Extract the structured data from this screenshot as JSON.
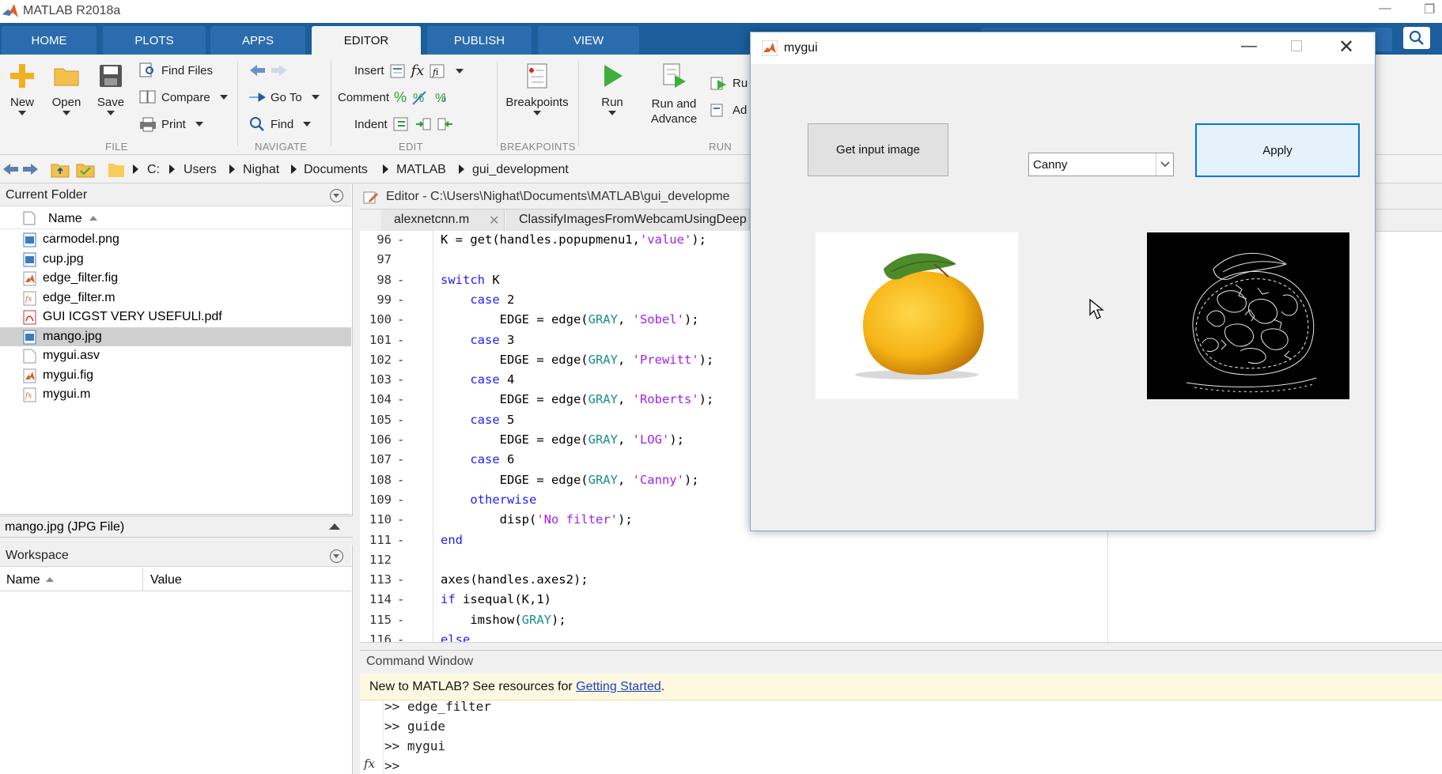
{
  "app": {
    "title": "MATLAB R2018a"
  },
  "ribbon": {
    "tabs": [
      "HOME",
      "PLOTS",
      "APPS",
      "EDITOR",
      "PUBLISH",
      "VIEW"
    ],
    "file": {
      "new": "New",
      "open": "Open",
      "save": "Save",
      "find_files": "Find Files",
      "compare": "Compare",
      "print": "Print",
      "group": "FILE"
    },
    "navigate": {
      "go_to": "Go To",
      "find": "Find",
      "group": "NAVIGATE"
    },
    "edit": {
      "insert": "Insert",
      "comment": "Comment",
      "indent": "Indent",
      "group": "EDIT"
    },
    "breakpoints": {
      "label": "Breakpoints",
      "group": "BREAKPOINTS"
    },
    "run": {
      "run": "Run",
      "run_advance_1": "Run and",
      "run_advance_2": "Advance",
      "run_section": "Ru",
      "advance": "Ad",
      "group": "RUN"
    }
  },
  "address": {
    "crumbs": [
      "C:",
      "Users",
      "Nighat",
      "Documents",
      "MATLAB",
      "gui_development"
    ]
  },
  "current_folder": {
    "title": "Current Folder",
    "column": "Name",
    "files": [
      {
        "name": "carmodel.png",
        "icon": "image-file-icon"
      },
      {
        "name": "cup.jpg",
        "icon": "image-file-icon"
      },
      {
        "name": "edge_filter.fig",
        "icon": "fig-file-icon"
      },
      {
        "name": "edge_filter.m",
        "icon": "m-file-icon"
      },
      {
        "name": "GUI ICGST VERY USEFULl.pdf",
        "icon": "pdf-file-icon"
      },
      {
        "name": "mango.jpg",
        "icon": "image-file-icon"
      },
      {
        "name": "mygui.asv",
        "icon": "generic-file-icon"
      },
      {
        "name": "mygui.fig",
        "icon": "fig-file-icon"
      },
      {
        "name": "mygui.m",
        "icon": "m-file-icon"
      }
    ],
    "selected": "mango.jpg",
    "details": "mango.jpg  (JPG File)"
  },
  "workspace": {
    "title": "Workspace",
    "col_name": "Name",
    "col_value": "Value"
  },
  "editor": {
    "header": "Editor - C:\\Users\\Nighat\\Documents\\MATLAB\\gui_developme",
    "tabs": [
      "alexnetcnn.m",
      "ClassifyImagesFromWebcamUsingDeep"
    ],
    "lines": [
      {
        "n": "96",
        "d": "-",
        "code": "K = get(handles.popupmenu1,'value');"
      },
      {
        "n": "97",
        "d": "",
        "code": ""
      },
      {
        "n": "98",
        "d": "-",
        "code": "switch K"
      },
      {
        "n": "99",
        "d": "-",
        "code": "    case 2"
      },
      {
        "n": "100",
        "d": "-",
        "code": "        EDGE = edge(GRAY, 'Sobel');"
      },
      {
        "n": "101",
        "d": "-",
        "code": "    case 3"
      },
      {
        "n": "102",
        "d": "-",
        "code": "        EDGE = edge(GRAY, 'Prewitt');"
      },
      {
        "n": "103",
        "d": "-",
        "code": "    case 4"
      },
      {
        "n": "104",
        "d": "-",
        "code": "        EDGE = edge(GRAY, 'Roberts');"
      },
      {
        "n": "105",
        "d": "-",
        "code": "    case 5"
      },
      {
        "n": "106",
        "d": "-",
        "code": "        EDGE = edge(GRAY, 'LOG');"
      },
      {
        "n": "107",
        "d": "-",
        "code": "    case 6"
      },
      {
        "n": "108",
        "d": "-",
        "code": "        EDGE = edge(GRAY, 'Canny');"
      },
      {
        "n": "109",
        "d": "-",
        "code": "    otherwise"
      },
      {
        "n": "110",
        "d": "-",
        "code": "        disp('No filter');"
      },
      {
        "n": "111",
        "d": "-",
        "code": "end"
      },
      {
        "n": "112",
        "d": "",
        "code": ""
      },
      {
        "n": "113",
        "d": "-",
        "code": "axes(handles.axes2);"
      },
      {
        "n": "114",
        "d": "-",
        "code": "if isequal(K,1)"
      },
      {
        "n": "115",
        "d": "-",
        "code": "    imshow(GRAY);"
      },
      {
        "n": "116",
        "d": "-",
        "code": "else"
      }
    ]
  },
  "command_window": {
    "title": "Command Window",
    "banner_text": "New to MATLAB? See resources for ",
    "banner_link": "Getting Started",
    "banner_end": ".",
    "history": [
      ">> edge_filter",
      ">> guide",
      ">> mygui"
    ],
    "prompt": ">>"
  },
  "mygui": {
    "title": "mygui",
    "get_input": "Get input image",
    "dropdown_value": "Canny",
    "apply": "Apply"
  },
  "colors": {
    "ribbon_blue": "#1c5d9c",
    "keyword": "#2020ff",
    "string": "#a020f0",
    "variable": "#1a8f8f",
    "apply_border": "#0078d7"
  }
}
